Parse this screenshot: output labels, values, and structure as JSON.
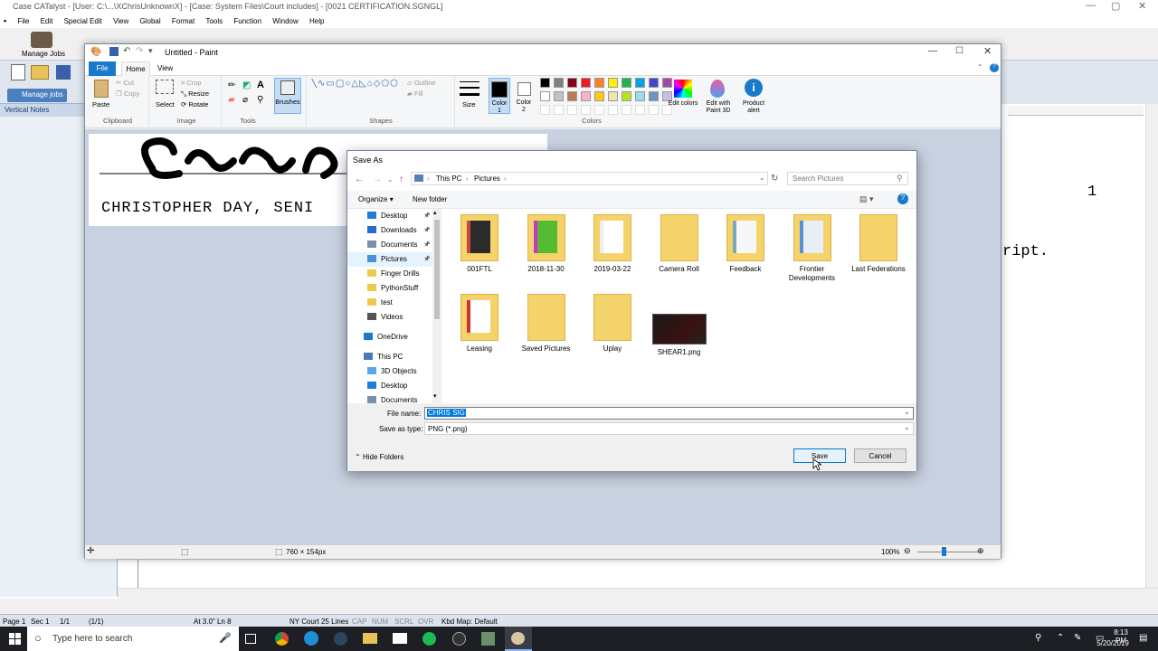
{
  "case_catalyst": {
    "title": "Case CATalyst - [User: C:\\...\\XChrisUnknownX] - [Case: System Files\\Court includes] - [0021 CERTIFICATION.SGNGL]",
    "menu": [
      "File",
      "Edit",
      "Special Edit",
      "View",
      "Global",
      "Format",
      "Tools",
      "Function",
      "Window",
      "Help"
    ],
    "manage_jobs_label": "Manage Jobs",
    "manage_jobs_tab": "Manage jobs",
    "vertical_notes": "Vertical Notes",
    "page_number": "1",
    "doc_text": "ript.",
    "status": {
      "page": "Page 1",
      "sec": "Sec 1",
      "of": "1/1",
      "count": "(1/1)",
      "at": "At 3.0\" Ln 8",
      "court": "NY Court 25 Lines",
      "cap": "CAP",
      "num": "NUM",
      "scrl": "SCRL",
      "ovr": "OVR",
      "kbd": "Kbd Map: Default"
    }
  },
  "taskbar": {
    "search_placeholder": "Type here to search",
    "time": "8:13 PM",
    "date": "5/20/2019"
  },
  "paint": {
    "title": "Untitled - Paint",
    "tabs": {
      "file": "File",
      "home": "Home",
      "view": "View"
    },
    "ribbon": {
      "paste": "Paste",
      "cut": "Cut",
      "copy": "Copy",
      "clipboard": "Clipboard",
      "select": "Select",
      "crop": "Crop",
      "resize": "Resize",
      "rotate": "Rotate",
      "image": "Image",
      "tools": "Tools",
      "brushes": "Brushes",
      "outline": "Outline",
      "fill": "Fill",
      "shapes": "Shapes",
      "size": "Size",
      "color1": "Color 1",
      "color2": "Color 2",
      "colors": "Colors",
      "edit_colors": "Edit colors",
      "edit_paint3d": "Edit with Paint 3D",
      "product_alert": "Product alert"
    },
    "canvas_text": "CHRISTOPHER DAY, SENI",
    "canvas_size": "760 × 154px",
    "zoom": "100%"
  },
  "palette": [
    "#000000",
    "#7f7f7f",
    "#880015",
    "#ed1c24",
    "#ff7f27",
    "#fff200",
    "#22b14c",
    "#00a2e8",
    "#3f48cc",
    "#a349a4",
    "#ffffff",
    "#c3c3c3",
    "#b97a57",
    "#ffaec9",
    "#ffc90e",
    "#efe4b0",
    "#b5e61d",
    "#99d9ea",
    "#7092be",
    "#c8bfe7"
  ],
  "save_dialog": {
    "title": "Save As",
    "breadcrumb": [
      "This PC",
      "Pictures"
    ],
    "search_placeholder": "Search Pictures",
    "organize": "Organize",
    "new_folder": "New folder",
    "tree": [
      {
        "label": "Desktop",
        "icon": "desktop-icon"
      },
      {
        "label": "Downloads",
        "icon": "downloads-icon"
      },
      {
        "label": "Documents",
        "icon": "documents-icon"
      },
      {
        "label": "Pictures",
        "icon": "pictures-icon"
      },
      {
        "label": "Finger Drills",
        "icon": "folder-icon"
      },
      {
        "label": "PythonStuff",
        "icon": "folder-icon"
      },
      {
        "label": "test",
        "icon": "folder-icon"
      },
      {
        "label": "Videos",
        "icon": "videos-icon"
      },
      {
        "label": "OneDrive",
        "icon": "onedrive-icon"
      },
      {
        "label": "This PC",
        "icon": "computer-icon"
      },
      {
        "label": "3D Objects",
        "icon": "3d-objects-icon"
      },
      {
        "label": "Desktop",
        "icon": "desktop-icon"
      },
      {
        "label": "Documents",
        "icon": "documents-icon"
      }
    ],
    "files": [
      {
        "label": "001FTL",
        "kind": "folder"
      },
      {
        "label": "2018-11-30",
        "kind": "folder"
      },
      {
        "label": "2019-03-22",
        "kind": "folder"
      },
      {
        "label": "Camera Roll",
        "kind": "folder"
      },
      {
        "label": "Feedback",
        "kind": "folder"
      },
      {
        "label": "Frontier Developments",
        "kind": "folder"
      },
      {
        "label": "Last Federations",
        "kind": "folder"
      },
      {
        "label": "Leasing",
        "kind": "folder"
      },
      {
        "label": "Saved Pictures",
        "kind": "folder"
      },
      {
        "label": "Uplay",
        "kind": "folder"
      },
      {
        "label": "SHEAR1.png",
        "kind": "image"
      }
    ],
    "file_name_label": "File name:",
    "file_name_value": "CHRIS SIG",
    "save_type_label": "Save as type:",
    "save_type_value": "PNG (*.png)",
    "hide_folders": "Hide Folders",
    "save": "Save",
    "cancel": "Cancel"
  }
}
